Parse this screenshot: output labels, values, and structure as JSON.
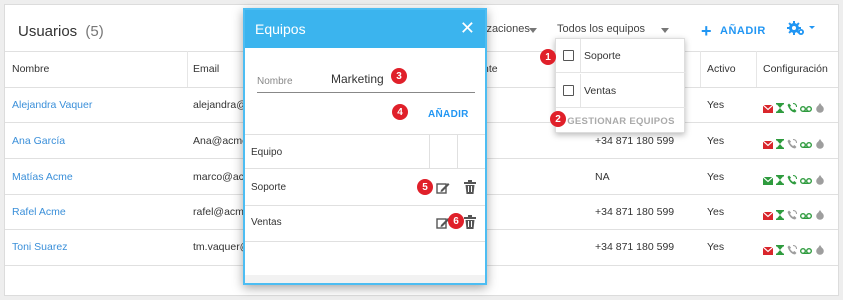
{
  "header": {
    "title": "Usuarios",
    "count": "(5)",
    "filter_org": "izaciones",
    "filter_teams": "Todos los equipos",
    "add_label": "AÑADIR"
  },
  "table": {
    "columns": [
      "Nombre",
      "Email",
      "nte",
      "Activo",
      "Configuración"
    ],
    "rows": [
      {
        "name": "Alejandra Vaquer",
        "email": "alejandra@a",
        "phone": "",
        "active": "Yes",
        "icons": [
          "mail-red",
          "hourglass-green",
          "phone-green",
          "voicemail-green",
          "cloud-gray"
        ]
      },
      {
        "name": "Ana García",
        "email": "Ana@acme.",
        "phone": "+34 871 180 599",
        "active": "Yes",
        "icons": [
          "mail-red",
          "hourglass-green",
          "phone-gray",
          "voicemail-green",
          "cloud-gray"
        ]
      },
      {
        "name": "Matías Acme",
        "email": "marco@acme",
        "phone": "NA",
        "active": "Yes",
        "icons": [
          "mail-green",
          "hourglass-green",
          "phone-green",
          "voicemail-green",
          "cloud-gray"
        ]
      },
      {
        "name": "Rafel Acme",
        "email": "rafel@acme.",
        "phone": "+34 871 180 599",
        "active": "Yes",
        "icons": [
          "mail-red",
          "hourglass-green",
          "phone-gray",
          "voicemail-green",
          "cloud-gray"
        ]
      },
      {
        "name": "Toni Suarez",
        "email": "tm.vaquer@",
        "phone": "+34 871 180 599",
        "active": "Yes",
        "icons": [
          "mail-red",
          "hourglass-green",
          "phone-gray",
          "voicemail-green",
          "cloud-gray"
        ]
      }
    ]
  },
  "dropdown": {
    "items": [
      "Soporte",
      "Ventas"
    ],
    "manage_label": "GESTIONAR EQUIPOS"
  },
  "modal": {
    "title": "Equipos",
    "close": "✕",
    "input_label": "Nombre",
    "input_value": "Marketing",
    "add_label": "AÑADIR",
    "column": "Equipo",
    "teams": [
      "Soporte",
      "Ventas"
    ]
  },
  "badges": [
    "1",
    "2",
    "3",
    "4",
    "5",
    "6"
  ],
  "colors": {
    "accent": "#2196f3",
    "modal_header": "#3bb4ee",
    "link": "#3a8fd9",
    "badge": "#e0202a",
    "icon_green": "#2e9b3e",
    "icon_red": "#d9262c"
  }
}
